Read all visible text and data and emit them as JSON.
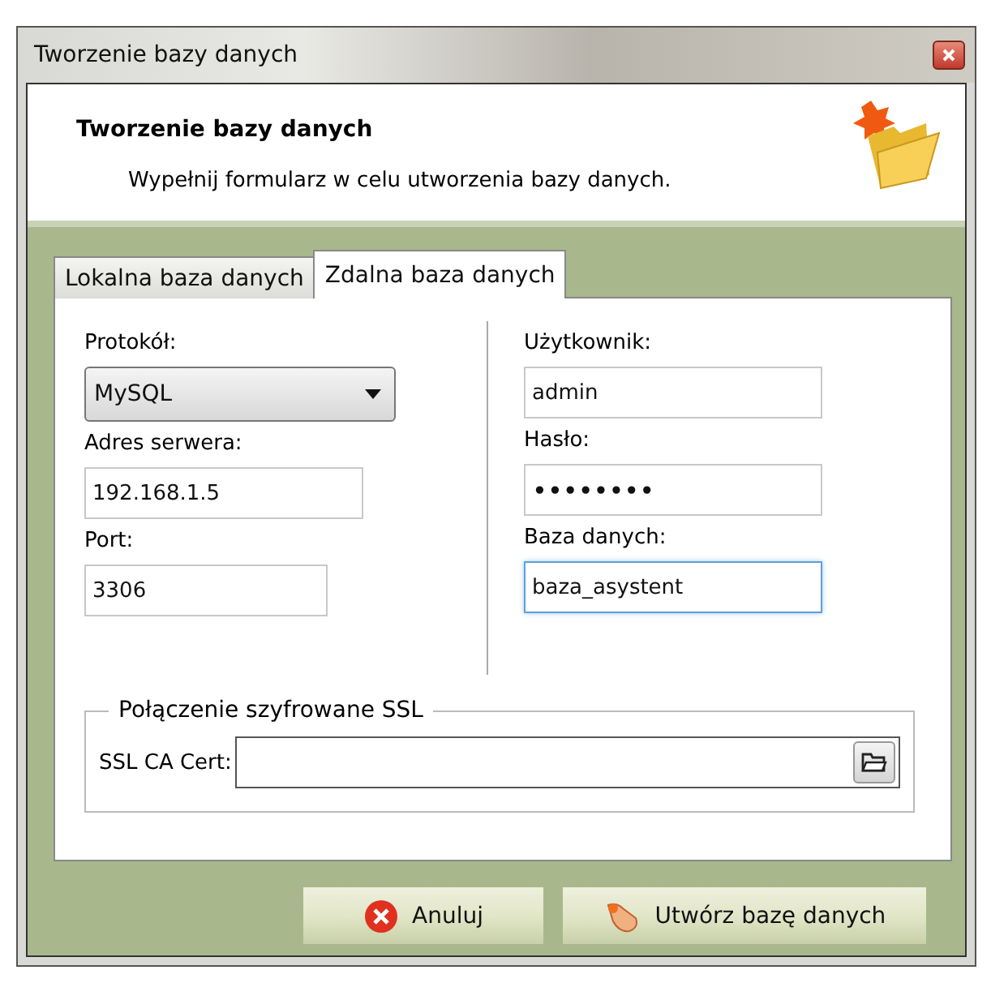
{
  "window": {
    "title": "Tworzenie bazy danych"
  },
  "header": {
    "title": "Tworzenie bazy danych",
    "subtitle": "Wypełnij formularz w celu utworzenia bazy danych."
  },
  "tabs": [
    {
      "label": "Lokalna baza danych",
      "selected": false
    },
    {
      "label": "Zdalna baza danych",
      "selected": true
    }
  ],
  "left_fields": [
    {
      "label": "Protokół:",
      "kind": "select",
      "value": "MySQL"
    },
    {
      "label": "Adres serwera:",
      "kind": "text",
      "value": "192.168.1.5"
    },
    {
      "label": "Port:",
      "kind": "short",
      "value": "3306"
    }
  ],
  "right_fields": [
    {
      "label": "Użytkownik:",
      "kind": "text",
      "value": "admin",
      "focused": false
    },
    {
      "label": "Hasło:",
      "kind": "password",
      "value": "••••••••",
      "focused": false
    },
    {
      "label": "Baza danych:",
      "kind": "text",
      "value": "baza_asystent",
      "focused": true
    }
  ],
  "ssl_group": {
    "title": "Połączenie szyfrowane SSL",
    "label": "SSL CA Cert:"
  },
  "buttons": [
    {
      "label": "Anuluj",
      "kind": "cancel"
    },
    {
      "label": "Utwórz bazę danych",
      "kind": "create"
    }
  ]
}
